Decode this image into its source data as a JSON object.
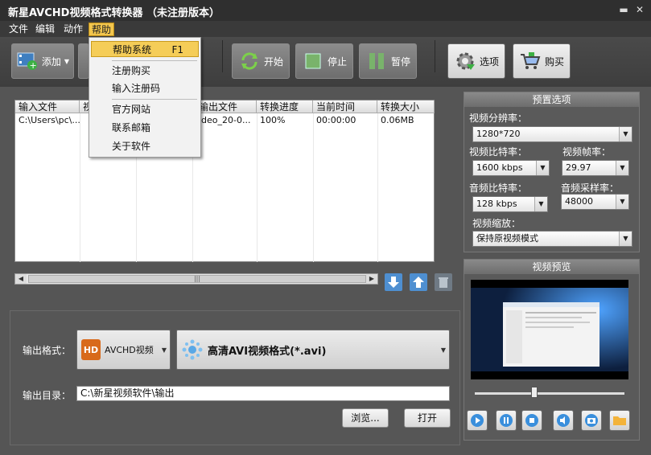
{
  "window": {
    "title": "新星AVCHD视频格式转换器 （未注册版本）"
  },
  "menubar": {
    "items": [
      "文件",
      "编辑",
      "动作",
      "帮助"
    ]
  },
  "help_menu": {
    "items": [
      {
        "label": "帮助系统",
        "shortcut": "F1"
      },
      {
        "label": "注册购买"
      },
      {
        "label": "输入注册码"
      },
      {
        "label": "官方网站"
      },
      {
        "label": "联系邮箱"
      },
      {
        "label": "关于软件"
      }
    ]
  },
  "toolbar": {
    "add_label": "添加",
    "start_label": "开始",
    "stop_label": "停止",
    "pause_label": "暂停",
    "options_label": "选项",
    "buy_label": "购买"
  },
  "file_list": {
    "headers": [
      "输入文件",
      "视",
      "",
      "",
      "输出文件",
      "转换进度",
      "当前时间",
      "转换大小"
    ],
    "rows": [
      [
        "C:\\Users\\pc\\...",
        "",
        "",
        "",
        "ideo_20-0...",
        "100%",
        "00:00:00",
        "0.06MB"
      ]
    ]
  },
  "presets": {
    "title": "预置选项",
    "resolution_label": "视频分辨率：",
    "resolution_value": "1280*720",
    "vbitrate_label": "视频比特率：",
    "vbitrate_value": "1600 kbps",
    "framerate_label": "视频帧率：",
    "framerate_value": "29.97",
    "abitrate_label": "音频比特率：",
    "abitrate_value": "128 kbps",
    "samplerate_label": "音频采样率：",
    "samplerate_value": "48000",
    "scale_label": "视频缩放：",
    "scale_value": "保持原视频模式"
  },
  "preview": {
    "title": "视频预览"
  },
  "output": {
    "format_label": "输出格式：",
    "category_value": "AVCHD视频",
    "category_icon_text": "HD",
    "format_value": "高清AVI视频格式(*.avi)",
    "dir_label": "输出目录：",
    "dir_value": "C:\\新星视频软件\\输出",
    "browse_label": "浏览...",
    "open_label": "打开"
  },
  "colors": {
    "accent": "#f3c64d",
    "background": "#555555"
  }
}
